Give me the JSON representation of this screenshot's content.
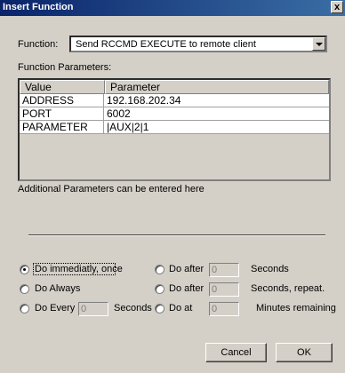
{
  "window": {
    "title": "Insert Function",
    "close_label": "x"
  },
  "function": {
    "label": "Function:",
    "selected": "Send RCCMD EXECUTE to remote client"
  },
  "params_label": "Function Parameters:",
  "grid": {
    "headers": [
      "Value",
      "Parameter"
    ],
    "rows": [
      [
        "ADDRESS",
        "192.168.202.34"
      ],
      [
        "PORT",
        "6002"
      ],
      [
        "PARAMETER",
        "|AUX|2|1"
      ]
    ]
  },
  "additional_label": "Additional Parameters can be entered here",
  "options": {
    "immediately": "Do immediatly, once",
    "always": "Do Always",
    "every": "Do Every",
    "every_value": "0",
    "every_unit": "Seconds",
    "after1": "Do after",
    "after1_value": "0",
    "after1_unit": "Seconds",
    "after2": "Do after",
    "after2_value": "0",
    "after2_unit": "Seconds, repeat.",
    "at": "Do at",
    "at_value": "0",
    "at_unit": "Minutes remaining"
  },
  "buttons": {
    "cancel": "Cancel",
    "ok": "OK"
  }
}
